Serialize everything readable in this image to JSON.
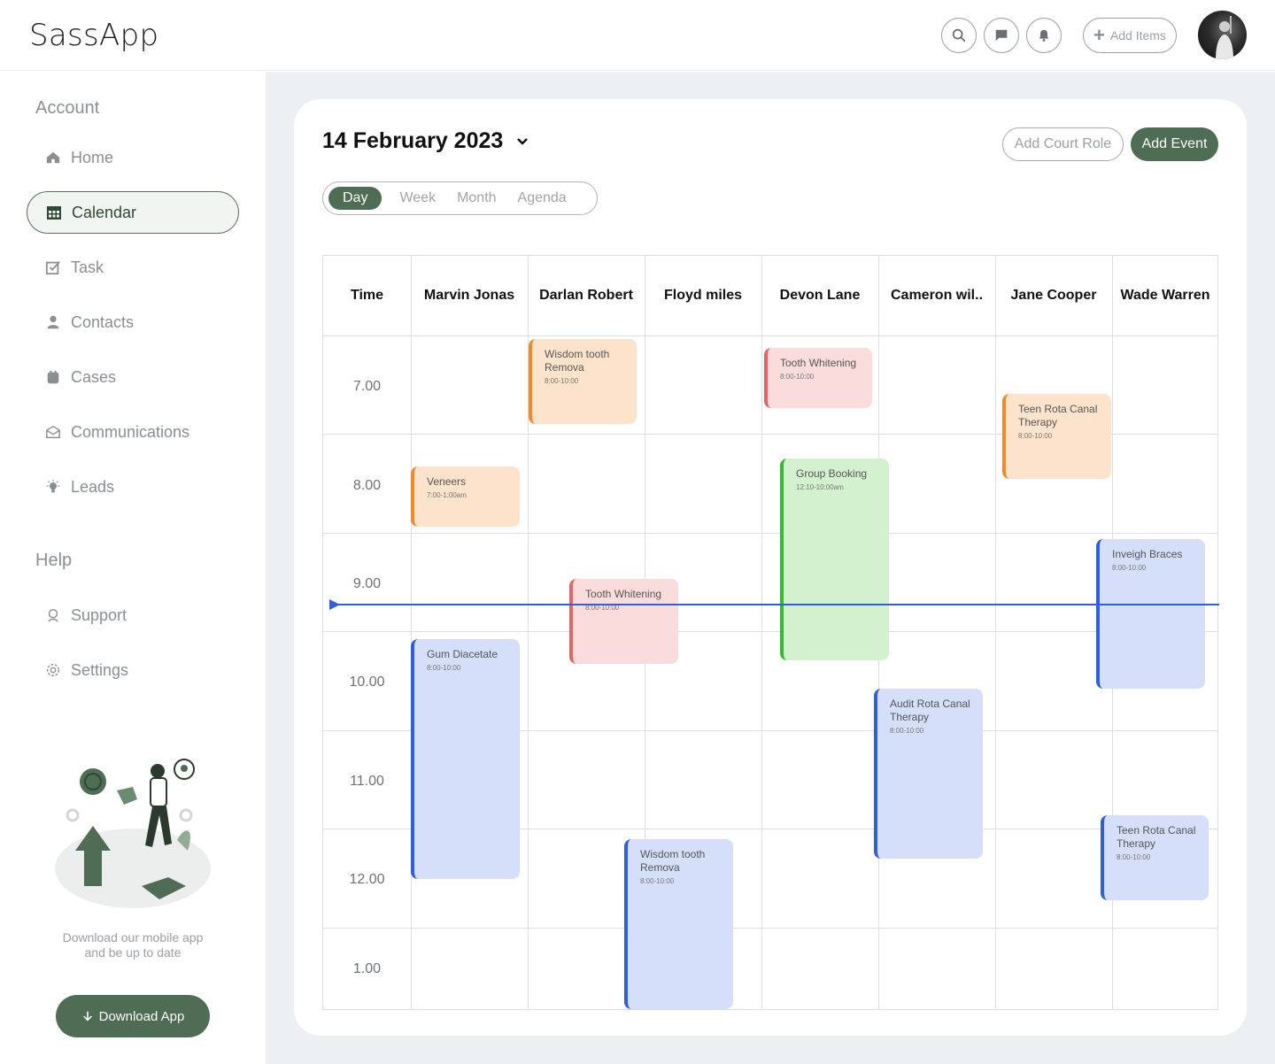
{
  "app": {
    "name": "SassApp"
  },
  "header": {
    "add_items": "Add Items"
  },
  "sidebar": {
    "account_title": "Account",
    "items": [
      {
        "label": "Home"
      },
      {
        "label": "Calendar"
      },
      {
        "label": "Task"
      },
      {
        "label": "Contacts"
      },
      {
        "label": "Cases"
      },
      {
        "label": "Communications"
      },
      {
        "label": "Leads"
      }
    ],
    "help_title": "Help",
    "help_items": [
      {
        "label": "Support"
      },
      {
        "label": "Settings"
      }
    ],
    "promo_line1": "Download our mobile app",
    "promo_line2": "and be up to date",
    "download_label": "Download App"
  },
  "calendar": {
    "date": "14 February 2023",
    "add_court_role": "Add Court Role",
    "add_event": "Add Event",
    "tabs": [
      "Day",
      "Week",
      "Month",
      "Agenda"
    ],
    "active_tab": "Day",
    "time_header": "Time",
    "columns": [
      "Marvin Jonas",
      "Darlan Robert",
      "Floyd miles",
      "Devon Lane",
      "Cameron wil..",
      "Jane Cooper",
      "Wade Warren"
    ],
    "times": [
      "7.00",
      "8.00",
      "9.00",
      "10.00",
      "11.00",
      "12.00",
      "1.00"
    ],
    "events": [
      {
        "title": "Wisdom tooth Remova",
        "time": "8:00-10:00"
      },
      {
        "title": "Tooth Whitening",
        "time": "8:00-10:00"
      },
      {
        "title": "Teen Rota Canal Therapy",
        "time": "8:00-10:00"
      },
      {
        "title": "Veneers",
        "time": "7:00-1:00am"
      },
      {
        "title": "Group Booking",
        "time": "12:10-10:00am"
      },
      {
        "title": "Inveigh Braces",
        "time": "8:00-10:00"
      },
      {
        "title": "Tooth Whitening",
        "time": "8:00-10:00"
      },
      {
        "title": "Gum Diacetate",
        "time": "8:00-10:00"
      },
      {
        "title": "Audit Rota Canal Therapy",
        "time": "8:00-10:00"
      },
      {
        "title": "Teen Rota Canal Therapy",
        "time": "8:00-10:00"
      },
      {
        "title": "Wisdom tooth Remova",
        "time": "8:00-10:00"
      }
    ]
  },
  "colors": {
    "brand_green": "#4f6c55",
    "event_orange": "#f08a2a",
    "event_red": "#e46464",
    "event_green": "#2ec02a",
    "event_blue": "#2f5fe0"
  }
}
